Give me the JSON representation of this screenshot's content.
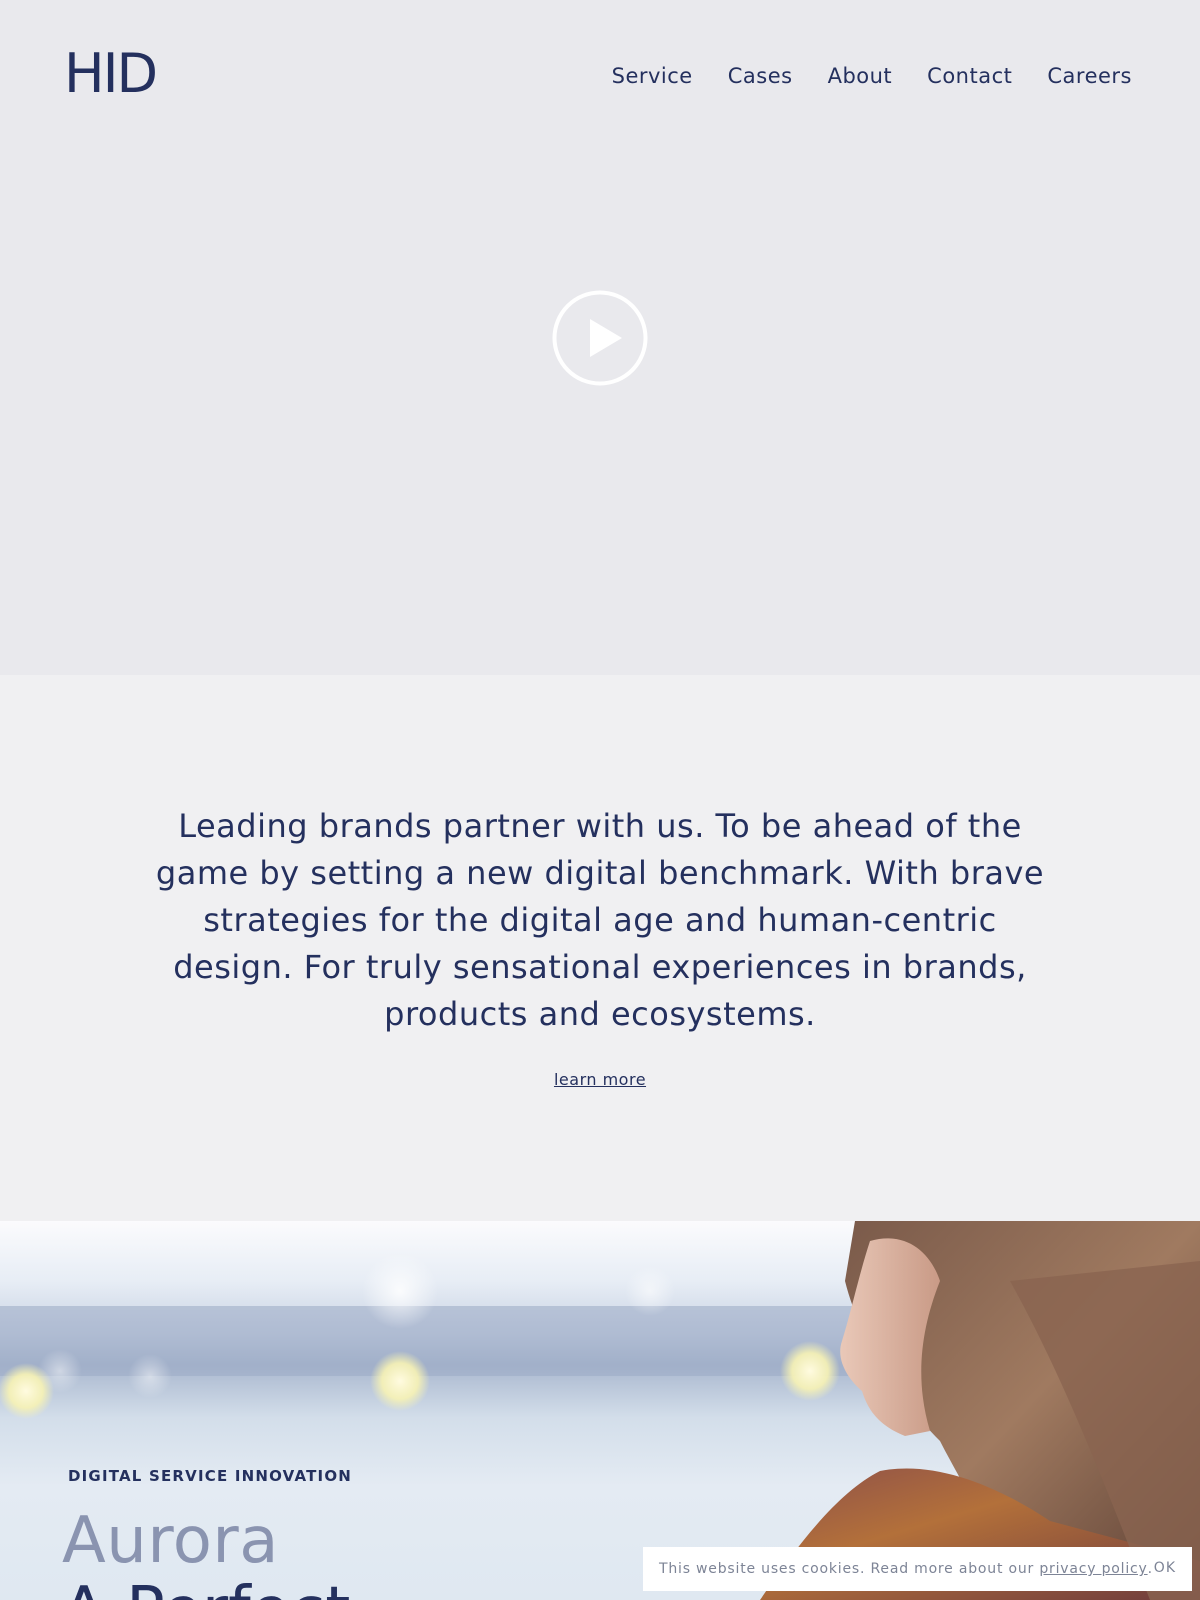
{
  "header": {
    "logo": "HID",
    "nav": [
      "Service",
      "Cases",
      "About",
      "Contact",
      "Careers"
    ]
  },
  "hero": {
    "play_icon": "play-circle-icon"
  },
  "intro": {
    "text": "Leading brands partner with us. To be ahead of the game by setting a new digital benchmark. With brave strategies for the digital age and human-centric design. For truly sensational experiences in brands, products and ecosystems.",
    "learn_more": "learn more"
  },
  "case": {
    "kicker": "DIGITAL SERVICE INNOVATION",
    "title": "Aurora",
    "subtitle": "A Perfect"
  },
  "cookie": {
    "text": "This website uses cookies. Read more about our ",
    "link": "privacy policy",
    "suffix": ".",
    "ok": "OK"
  },
  "colors": {
    "brand": "#24305e",
    "hero_bg": "#e9e9ed",
    "intro_bg": "#f0f0f2"
  }
}
